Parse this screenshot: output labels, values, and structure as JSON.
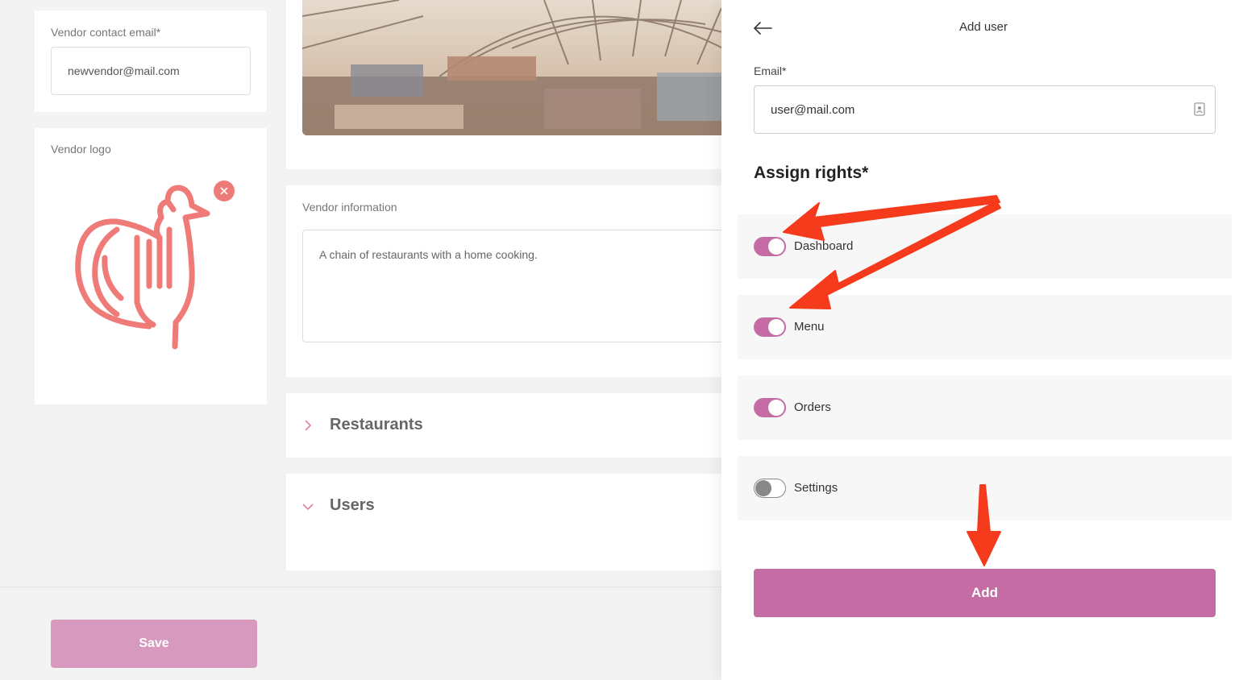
{
  "vendor_form": {
    "contact_email_label": "Vendor contact email*",
    "contact_email_value": "newvendor@mail.com",
    "logo_label": "Vendor logo",
    "info_label": "Vendor information",
    "info_value": "A chain of restaurants with a home cooking.",
    "save_label": "Save"
  },
  "sections": {
    "restaurants": "Restaurants",
    "users": "Users"
  },
  "panel": {
    "title": "Add user",
    "email_label": "Email*",
    "email_value": "user@mail.com",
    "rights_title": "Assign rights*",
    "rights": [
      {
        "label": "Dashboard",
        "enabled": true
      },
      {
        "label": "Menu",
        "enabled": true
      },
      {
        "label": "Orders",
        "enabled": true
      },
      {
        "label": "Settings",
        "enabled": false
      }
    ],
    "add_label": "Add"
  },
  "colors": {
    "accent": "#c46ca3",
    "save_disabled": "#d79abe",
    "logo": "#ef7b78",
    "annotation_arrow": "#f53b1c"
  }
}
